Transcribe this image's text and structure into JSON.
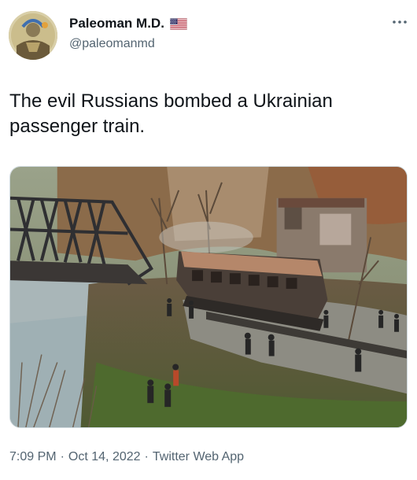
{
  "author": {
    "display_name": "Paleoman M.D.",
    "handle": "@paleomanmd",
    "flag_icon": "us-flag-icon"
  },
  "tweet": {
    "text": "The evil Russians bombed a Ukrainian passenger train.",
    "image_subject": "photo of a bombed, burned-out passenger train car derailed beside a damaged railway bridge over a river, with people standing around the wreckage"
  },
  "meta": {
    "time": "7:09 PM",
    "separator": "·",
    "date": "Oct 14, 2022",
    "source": "Twitter Web App"
  },
  "icons": {
    "more": "more-options-icon"
  },
  "colors": {
    "text_primary": "#0f1419",
    "text_secondary": "#536471",
    "border": "#cfd9de"
  }
}
